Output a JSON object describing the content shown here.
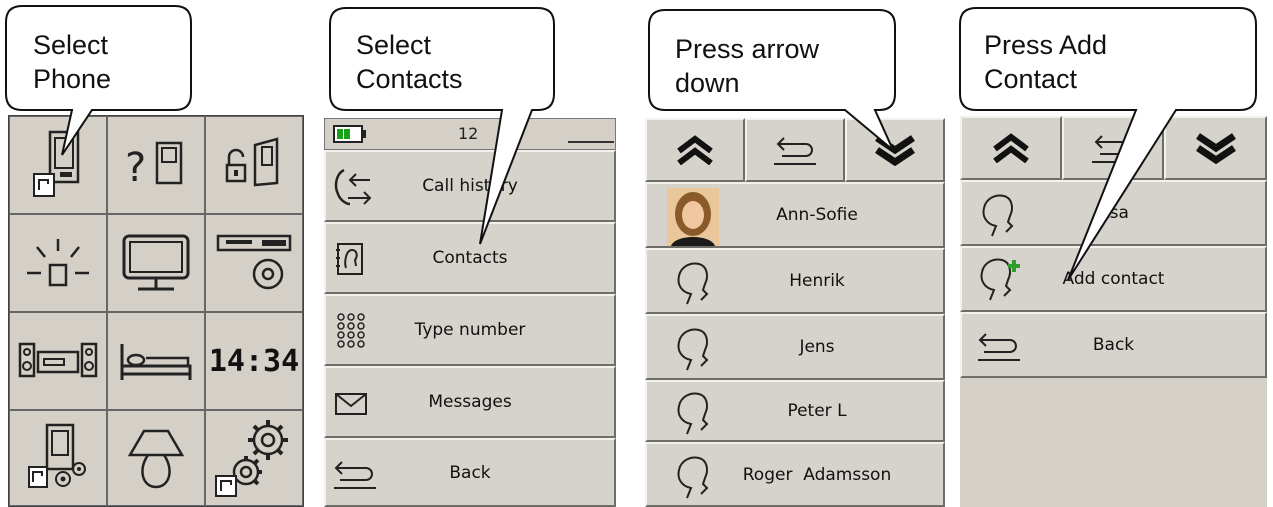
{
  "panel1": {
    "callout": {
      "line1": "Select",
      "line2": "Phone"
    },
    "clock": "14:34",
    "icons": [
      "phone-icon",
      "help-door-icon",
      "unlock-door-icon",
      "light-icon",
      "tv-icon",
      "media-player-icon",
      "speakers-icon",
      "bed-icon",
      "clock",
      "phone-settings-icon",
      "lamp-icon",
      "settings-icon"
    ]
  },
  "panel2": {
    "callout": {
      "line1": "Select",
      "line2": "Contacts"
    },
    "status_time": "12",
    "menu": [
      {
        "label": "Call history",
        "icon": "call-history-icon"
      },
      {
        "label": "Contacts",
        "icon": "contacts-book-icon"
      },
      {
        "label": "Type number",
        "icon": "keypad-icon"
      },
      {
        "label": "Messages",
        "icon": "envelope-icon"
      },
      {
        "label": "Back",
        "icon": "back-arrow-icon"
      }
    ]
  },
  "panel3": {
    "callout": {
      "line1": "Press arrow",
      "line2": "down"
    },
    "contacts": [
      {
        "name": "Ann-Sofie",
        "icon": "contact-photo"
      },
      {
        "name": "Henrik",
        "icon": "person-head-icon"
      },
      {
        "name": "Jens",
        "icon": "person-head-icon"
      },
      {
        "name": "Peter L",
        "icon": "person-head-icon"
      },
      {
        "name": "Roger  Adamsson",
        "icon": "person-head-icon"
      }
    ]
  },
  "panel4": {
    "callout": {
      "line1": "Press Add",
      "line2": "Contact"
    },
    "items": [
      {
        "label": "Åsa",
        "icon": "person-head-icon"
      },
      {
        "label": "Add contact",
        "icon": "add-person-icon"
      },
      {
        "label": "Back",
        "icon": "back-arrow-icon"
      }
    ]
  },
  "colors": {
    "panel_bg": "#d4d0c8",
    "battery_green": "#19a119",
    "plus_green": "#2c9c2c"
  }
}
